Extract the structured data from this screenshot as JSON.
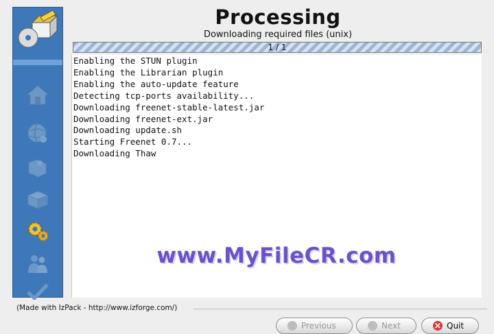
{
  "header": {
    "title": "Processing",
    "subtitle": "Downloading required files (unix)"
  },
  "progress": {
    "label": "1 / 1",
    "value": 1.0
  },
  "log": {
    "lines": [
      "Enabling the STUN plugin",
      "Enabling the Librarian plugin",
      "Enabling the auto-update feature",
      "Detecting tcp-ports availability...",
      "Downloading freenet-stable-latest.jar",
      "Downloading freenet-ext.jar",
      "Downloading update.sh",
      "Starting Freenet 0.7...",
      "Downloading Thaw"
    ]
  },
  "watermark": "www.MyFileCR.com",
  "footer": {
    "made_with": "(Made with IzPack - http://www.izforge.com/)"
  },
  "buttons": {
    "previous": "Previous",
    "next": "Next",
    "quit": "Quit"
  },
  "sidebar": {
    "steps": [
      "home-icon",
      "globe-icon",
      "puzzle-icon",
      "box-icon",
      "gears-icon",
      "users-icon",
      "checkmark-icon"
    ],
    "active_step": "gears-icon",
    "colors": {
      "background": "#3e78b8",
      "active": "#f2c230"
    }
  }
}
